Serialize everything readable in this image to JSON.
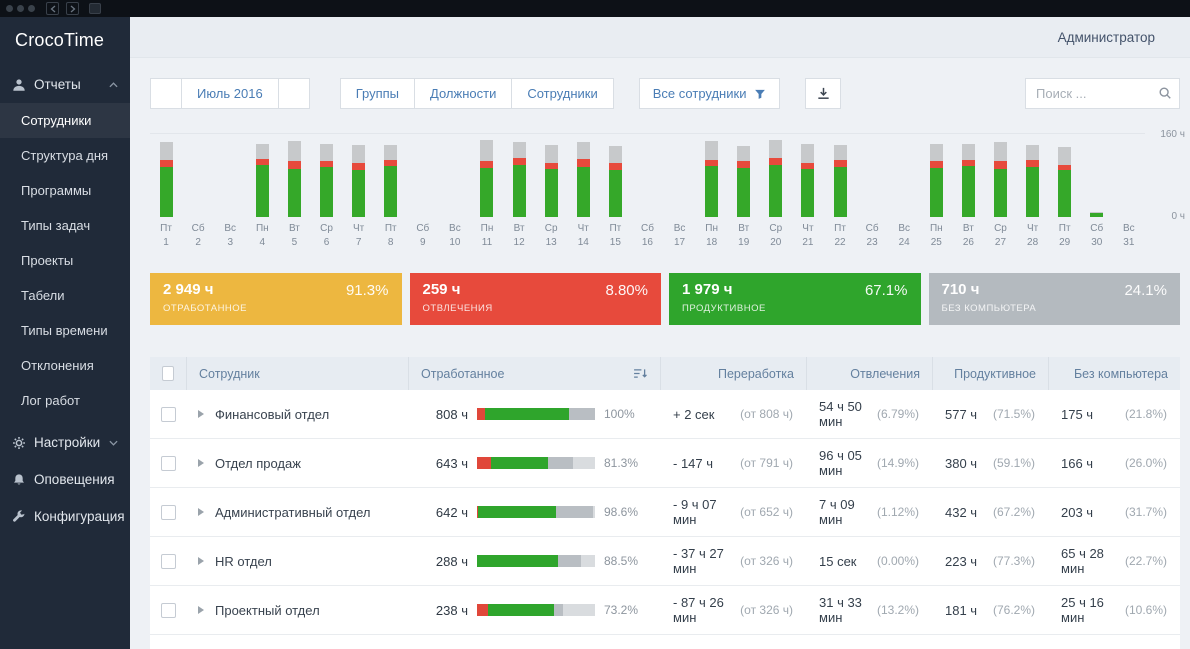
{
  "app": {
    "logo": "CrocoTime"
  },
  "header": {
    "user_menu": "Администратор"
  },
  "icons": {
    "reports-icon": "person",
    "settings-icon": "gear",
    "notifications-icon": "bell",
    "configuration-icon": "wrench",
    "search-icon": "magnifier",
    "download-icon": "arrow-down-tray",
    "filter-icon": "funnel",
    "sort-icon": "sort-lines-descending",
    "prev-month-icon": "triangle-left",
    "next-month-icon": "triangle-right",
    "expand-icon": "triangle-right",
    "chevron-up-icon": "chevron-up",
    "chevron-down-icon": "chevron-down"
  },
  "sidebar": {
    "reports": {
      "label": "Отчеты",
      "items": [
        {
          "label": "Сотрудники",
          "active": true
        },
        {
          "label": "Структура дня",
          "active": false
        },
        {
          "label": "Программы",
          "active": false
        },
        {
          "label": "Типы задач",
          "active": false
        },
        {
          "label": "Проекты",
          "active": false
        },
        {
          "label": "Табели",
          "active": false
        },
        {
          "label": "Типы времени",
          "active": false
        },
        {
          "label": "Отклонения",
          "active": false
        },
        {
          "label": "Лог работ",
          "active": false
        }
      ]
    },
    "settings": {
      "label": "Настройки"
    },
    "notifications": {
      "label": "Оповещения"
    },
    "configuration": {
      "label": "Конфигурация"
    }
  },
  "toolbar": {
    "period": "Июль 2016",
    "view_buttons": [
      "Группы",
      "Должности",
      "Сотрудники"
    ],
    "filter_label": "Все сотрудники",
    "search_placeholder": "Поиск ..."
  },
  "chart_data": {
    "type": "bar",
    "stacked": true,
    "title": "",
    "xlabel": "",
    "ylabel": "ч",
    "ylim": [
      0,
      160
    ],
    "y_axis_labels": {
      "top": "160 ч",
      "bottom": "0 ч"
    },
    "grid": "top-line-only",
    "legend_position": "none",
    "days": [
      {
        "weekday": "Пт",
        "day": "1"
      },
      {
        "weekday": "Сб",
        "day": "2"
      },
      {
        "weekday": "Вс",
        "day": "3"
      },
      {
        "weekday": "Пн",
        "day": "4"
      },
      {
        "weekday": "Вт",
        "day": "5"
      },
      {
        "weekday": "Ср",
        "day": "6"
      },
      {
        "weekday": "Чт",
        "day": "7"
      },
      {
        "weekday": "Пт",
        "day": "8"
      },
      {
        "weekday": "Сб",
        "day": "9"
      },
      {
        "weekday": "Вс",
        "day": "10"
      },
      {
        "weekday": "Пн",
        "day": "11"
      },
      {
        "weekday": "Вт",
        "day": "12"
      },
      {
        "weekday": "Ср",
        "day": "13"
      },
      {
        "weekday": "Чт",
        "day": "14"
      },
      {
        "weekday": "Пт",
        "day": "15"
      },
      {
        "weekday": "Сб",
        "day": "16"
      },
      {
        "weekday": "Вс",
        "day": "17"
      },
      {
        "weekday": "Пн",
        "day": "18"
      },
      {
        "weekday": "Вт",
        "day": "19"
      },
      {
        "weekday": "Ср",
        "day": "20"
      },
      {
        "weekday": "Чт",
        "day": "21"
      },
      {
        "weekday": "Пт",
        "day": "22"
      },
      {
        "weekday": "Сб",
        "day": "23"
      },
      {
        "weekday": "Вс",
        "day": "24"
      },
      {
        "weekday": "Пн",
        "day": "25"
      },
      {
        "weekday": "Вт",
        "day": "26"
      },
      {
        "weekday": "Ср",
        "day": "27"
      },
      {
        "weekday": "Чт",
        "day": "28"
      },
      {
        "weekday": "Пт",
        "day": "29"
      },
      {
        "weekday": "Сб",
        "day": "30"
      },
      {
        "weekday": "Вс",
        "day": "31"
      }
    ],
    "series": [
      {
        "name": "Продуктивное",
        "color": "#35a829",
        "values": [
          96,
          0,
          0,
          100,
          92,
          95,
          90,
          98,
          0,
          0,
          94,
          100,
          92,
          96,
          90,
          0,
          0,
          98,
          94,
          100,
          92,
          96,
          0,
          0,
          94,
          98,
          92,
          96,
          90,
          8,
          0
        ]
      },
      {
        "name": "Отвлечения",
        "color": "#e74a3c",
        "values": [
          12,
          0,
          0,
          10,
          14,
          12,
          12,
          10,
          0,
          0,
          12,
          12,
          10,
          14,
          12,
          0,
          0,
          10,
          12,
          12,
          10,
          12,
          0,
          0,
          12,
          10,
          14,
          12,
          10,
          0,
          0
        ]
      },
      {
        "name": "Без компьютера",
        "color": "#c7c9cb",
        "values": [
          34,
          0,
          0,
          30,
          38,
          32,
          36,
          30,
          0,
          0,
          40,
          30,
          36,
          32,
          34,
          0,
          0,
          36,
          30,
          34,
          38,
          30,
          0,
          0,
          34,
          32,
          36,
          30,
          34,
          2,
          0
        ]
      }
    ]
  },
  "summary_cards": [
    {
      "value": "2 949 ч",
      "label": "ОТРАБОТАННОЕ",
      "percent": "91.3%",
      "color": "#edb740"
    },
    {
      "value": "259 ч",
      "label": "ОТВЛЕЧЕНИЯ",
      "percent": "8.80%",
      "color": "#e74a3c"
    },
    {
      "value": "1 979 ч",
      "label": "ПРОДУКТИВНОЕ",
      "percent": "67.1%",
      "color": "#2fa52c"
    },
    {
      "value": "710 ч",
      "label": "БЕЗ КОМПЬЮТЕРА",
      "percent": "24.1%",
      "color": "#b4babf"
    }
  ],
  "table": {
    "columns": {
      "employee": "Сотрудник",
      "worked": "Отработанное",
      "overtime": "Переработка",
      "distractions": "Отвлечения",
      "productive": "Продуктивное",
      "no_computer": "Без компьютера"
    },
    "rows": [
      {
        "name": "Финансовый отдел",
        "worked": "808 ч",
        "percent": "100%",
        "bar": {
          "fill": 100,
          "red": 6.79,
          "green": 71.5,
          "gray": 21.8
        },
        "overtime": "+ 2 сек",
        "overtime_of": "(от 808 ч)",
        "distraction": "54 ч 50 мин",
        "distraction_pct": "(6.79%)",
        "productive": "577 ч",
        "productive_pct": "(71.5%)",
        "no_computer": "175 ч",
        "no_computer_pct": "(21.8%)"
      },
      {
        "name": "Отдел продаж",
        "worked": "643 ч",
        "percent": "81.3%",
        "bar": {
          "fill": 81.3,
          "red": 14.9,
          "green": 59.1,
          "gray": 26.0
        },
        "overtime": "- 147 ч",
        "overtime_of": "(от 791 ч)",
        "distraction": "96 ч 05 мин",
        "distraction_pct": "(14.9%)",
        "productive": "380 ч",
        "productive_pct": "(59.1%)",
        "no_computer": "166 ч",
        "no_computer_pct": "(26.0%)"
      },
      {
        "name": "Административный отдел",
        "worked": "642 ч",
        "percent": "98.6%",
        "bar": {
          "fill": 98.6,
          "red": 1.12,
          "green": 67.2,
          "gray": 31.7
        },
        "overtime": "- 9 ч 07 мин",
        "overtime_of": "(от 652 ч)",
        "distraction": "7 ч 09 мин",
        "distraction_pct": "(1.12%)",
        "productive": "432 ч",
        "productive_pct": "(67.2%)",
        "no_computer": "203 ч",
        "no_computer_pct": "(31.7%)"
      },
      {
        "name": "HR отдел",
        "worked": "288 ч",
        "percent": "88.5%",
        "bar": {
          "fill": 88.5,
          "red": 0,
          "green": 77.3,
          "gray": 22.7
        },
        "overtime": "- 37 ч 27 мин",
        "overtime_of": "(от 326 ч)",
        "distraction": "15 сек",
        "distraction_pct": "(0.00%)",
        "productive": "223 ч",
        "productive_pct": "(77.3%)",
        "no_computer": "65 ч 28 мин",
        "no_computer_pct": "(22.7%)"
      },
      {
        "name": "Проектный отдел",
        "worked": "238 ч",
        "percent": "73.2%",
        "bar": {
          "fill": 73.2,
          "red": 13.2,
          "green": 76.2,
          "gray": 10.6
        },
        "overtime": "- 87 ч 26 мин",
        "overtime_of": "(от 326 ч)",
        "distraction": "31 ч 33 мин",
        "distraction_pct": "(13.2%)",
        "productive": "181 ч",
        "productive_pct": "(76.2%)",
        "no_computer": "25 ч 16 мин",
        "no_computer_pct": "(10.6%)"
      }
    ]
  }
}
